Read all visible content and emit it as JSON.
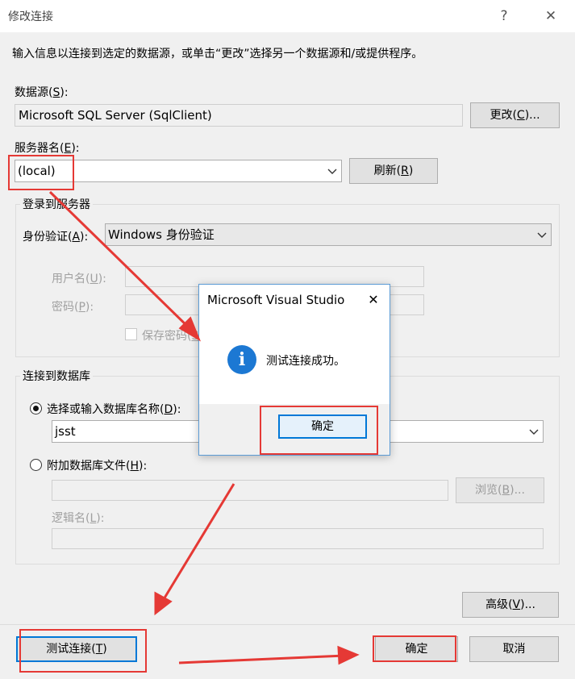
{
  "window": {
    "title": "修改连接",
    "help_glyph": "?",
    "close_glyph": "✕"
  },
  "intro_text": "输入信息以连接到选定的数据源，或单击“更改”选择另一个数据源和/或提供程序。",
  "data_source": {
    "label": "数据源",
    "key": "S",
    "value": "Microsoft SQL Server (SqlClient)",
    "change_button": {
      "label": "更改",
      "key": "C",
      "suffix": "..."
    }
  },
  "server": {
    "label": "服务器名",
    "key": "E",
    "value": "(local)",
    "refresh_button": {
      "label": "刷新",
      "key": "R"
    }
  },
  "login_group": {
    "title": "登录到服务器",
    "auth_label": "身份验证",
    "auth_key": "A",
    "auth_value": "Windows 身份验证",
    "username_label": "用户名",
    "username_key": "U",
    "password_label": "密码",
    "password_key": "P",
    "save_password_label": "保存密码",
    "save_password_key": "S"
  },
  "db_group": {
    "title": "连接到数据库",
    "select_db_label": "选择或输入数据库名称",
    "select_db_key": "D",
    "select_db_checked": true,
    "db_name": "jsst",
    "attach_label": "附加数据库文件",
    "attach_key": "H",
    "attach_checked": false,
    "browse_button": {
      "label": "浏览",
      "key": "B",
      "suffix": "..."
    },
    "logical_name_label": "逻辑名",
    "logical_name_key": "L"
  },
  "advanced_button": {
    "label": "高级",
    "key": "V",
    "suffix": "..."
  },
  "test_button": {
    "label": "测试连接",
    "key": "T"
  },
  "ok_button": {
    "label": "确定"
  },
  "cancel_button": {
    "label": "取消"
  },
  "message_box": {
    "title": "Microsoft Visual Studio",
    "close_glyph": "✕",
    "icon": "info-icon",
    "message": "测试连接成功。",
    "ok_label": "确定"
  },
  "colors": {
    "annotation_red": "#e53935",
    "focus_blue": "#0078d7",
    "info_blue": "#1c78d3"
  }
}
